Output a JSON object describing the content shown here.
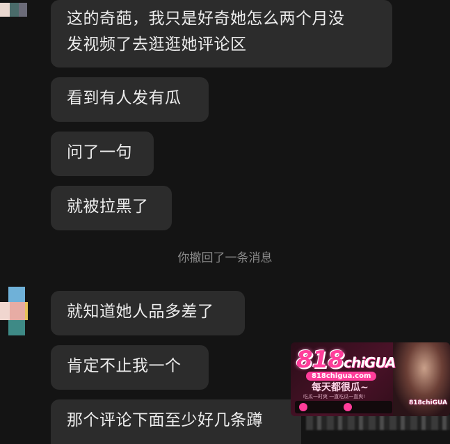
{
  "messages": {
    "top": {
      "lines": [
        "这的奇葩，我只是好奇她怎么两个月没",
        "发视频了去逛逛她评论区"
      ]
    },
    "m2": "看到有人发有瓜",
    "m3": "问了一句",
    "m4": "就被拉黑了",
    "recall_notice": "你撤回了一条消息",
    "m5": "就知道她人品多差了",
    "m6": "肯定不止我一个",
    "m7": "那个评论下面至少好几条蹲"
  },
  "watermark": {
    "logo_main": "818",
    "logo_suffix": "chiGUA",
    "url": "818chigua.com",
    "slogan": "每天都很瓜~",
    "sub": "吃瓜一时爽 一直吃瓜一直爽!",
    "corner": "818chiGUA"
  },
  "colors": {
    "background": "#141414",
    "bubble": "#2c2c2c",
    "text": "#ececec",
    "notice": "#8a8a8a",
    "brand": "#ff3d9a"
  }
}
